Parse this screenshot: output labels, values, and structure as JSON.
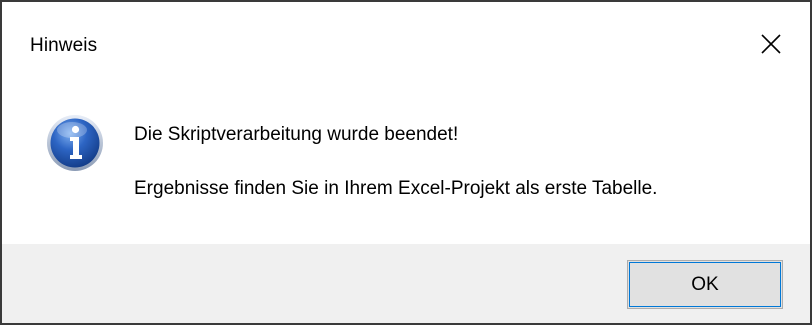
{
  "dialog": {
    "title": "Hinweis",
    "close_icon": "close-icon",
    "icon": "info-icon",
    "message_line1": "Die Skriptverarbeitung wurde beendet!",
    "message_line2": "Ergebnisse finden Sie in Ihrem Excel-Projekt als erste Tabelle.",
    "ok_label": "OK"
  },
  "colors": {
    "border": "#3a3a3a",
    "footer_background": "#f0f0f0",
    "button_background": "#e1e1e1",
    "button_focus": "#0078d7",
    "info_icon_blue": "#1f4fa8"
  }
}
